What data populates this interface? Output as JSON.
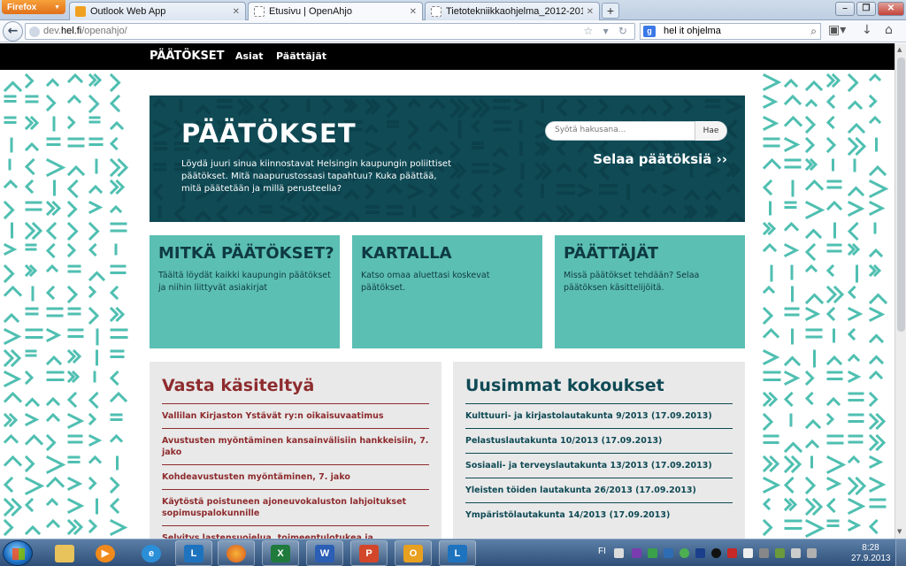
{
  "browser": {
    "menu_button": "Firefox",
    "tabs": [
      {
        "label": "Outlook Web App",
        "active": false
      },
      {
        "label": "Etusivu | OpenAhjo",
        "active": true
      },
      {
        "label": "Tietotekniikkaohjelma_2012-2014.pdf",
        "active": false
      }
    ],
    "new_tab": "+",
    "url_host": "dev.hel.fi",
    "url_path": "/openahjo/",
    "search_engine": "g",
    "search_value": "hel it ohjelma"
  },
  "site": {
    "nav": {
      "brand": "PÄÄTÖKSET",
      "items": [
        "Asiat",
        "Päättäjät"
      ]
    },
    "hero": {
      "logo": "PÄÄTÖKSET",
      "description": "Löydä juuri sinua kiinnostavat Helsingin kaupungin poliittiset päätökset. Mitä naapurustossasi tapahtuu? Kuka päättää, mitä päätetään ja millä perusteella?",
      "search_placeholder": "Syötä hakusana...",
      "search_button": "Hae",
      "browse_link": "Selaa päätöksiä ››"
    },
    "cards": [
      {
        "title": "MITKÄ PÄÄTÖKSET?",
        "text": "Täältä löydät kaikki kaupungin päätökset ja niihin liittyvät asiakirjat"
      },
      {
        "title": "KARTALLA",
        "text": "Katso omaa aluettasi koskevat päätökset."
      },
      {
        "title": "PÄÄTTÄJÄT",
        "text": "Missä päätökset tehdään? Selaa päätöksen käsittelijöitä."
      }
    ],
    "recent": {
      "title": "Vasta käsiteltyä",
      "items": [
        "Vallilan Kirjaston Ystävät ry:n oikaisuvaatimus",
        "Avustusten myöntäminen kansainvälisiin hankkeisiin, 7. jako",
        "Kohdeavustusten myöntäminen, 7. jako",
        "Käytöstä poistuneen ajoneuvokaluston lahjoitukset sopimuspalokunnille",
        "Selvitys lastensuojelua, toimeentulotukea ja"
      ]
    },
    "meetings": {
      "title": "Uusimmat kokoukset",
      "items": [
        "Kulttuuri- ja kirjastolautakunta 9/2013 (17.09.2013)",
        "Pelastuslautakunta 10/2013 (17.09.2013)",
        "Sosiaali- ja terveyslautakunta 13/2013 (17.09.2013)",
        "Yleisten töiden lautakunta 26/2013 (17.09.2013)",
        "Ympäristölautakunta 14/2013 (17.09.2013)"
      ]
    }
  },
  "taskbar": {
    "language": "FI",
    "time": "8:28",
    "date": "27.9.2013"
  },
  "colors": {
    "hero_bg": "#0f4a55",
    "card_bg": "#5cbfb3",
    "recent_accent": "#8e2c2e",
    "pattern": "#4fbfb1"
  }
}
